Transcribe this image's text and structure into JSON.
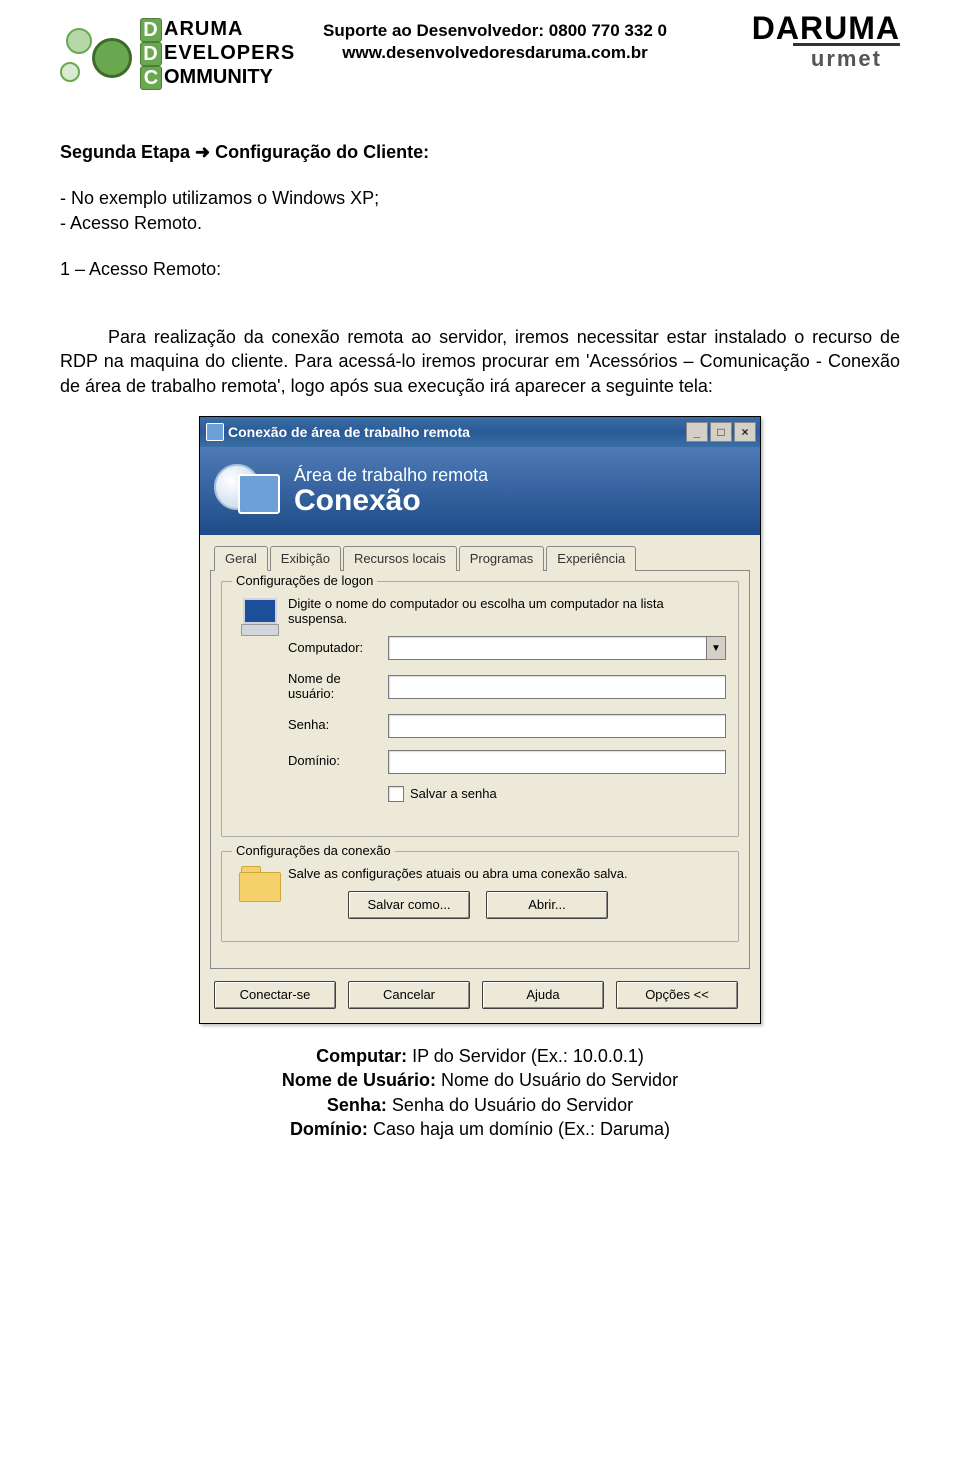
{
  "header": {
    "support_line": "Suporte ao Desenvolvedor: 0800 770 332 0",
    "site_line": "www.desenvolvedoresdaruma.com.br",
    "left_logo": {
      "line1": "ARUMA",
      "line2": "EVELOPERS",
      "line3": "OMMUNITY",
      "d": "D",
      "c": "C"
    },
    "right_logo": {
      "brand1": "DARUMA",
      "brand2": "urmet"
    }
  },
  "body": {
    "title_part1": "Segunda Etapa ",
    "title_part2": " Configuração do Cliente:",
    "line1": "- No exemplo utilizamos o Windows XP;",
    "line2": "- Acesso Remoto.",
    "step_title": "1 – Acesso Remoto:",
    "paragraph": "Para realização da conexão remota ao servidor, iremos necessitar estar instalado o recurso de RDP na maquina do cliente. Para acessá-lo iremos procurar em 'Acessórios – Comunicação - Conexão de área de trabalho remota', logo após sua execução irá aparecer a seguinte tela:"
  },
  "dialog": {
    "title": "Conexão de área de trabalho remota",
    "banner_line1": "Área de trabalho remota",
    "banner_line2": "Conexão",
    "tabs": [
      "Geral",
      "Exibição",
      "Recursos locais",
      "Programas",
      "Experiência"
    ],
    "group1": {
      "title": "Configurações de logon",
      "instr": "Digite o nome do computador ou escolha um computador na lista suspensa.",
      "lbl_computer": "Computador:",
      "lbl_user": "Nome de usuário:",
      "lbl_pass": "Senha:",
      "lbl_domain": "Domínio:",
      "chk_save": "Salvar a senha"
    },
    "group2": {
      "title": "Configurações da conexão",
      "instr": "Salve as configurações atuais ou abra uma conexão salva.",
      "btn_saveas": "Salvar como...",
      "btn_open": "Abrir..."
    },
    "buttons": {
      "connect": "Conectar-se",
      "cancel": "Cancelar",
      "help": "Ajuda",
      "options": "Opções <<"
    },
    "winbtns": {
      "min": "_",
      "max": "□",
      "close": "×"
    }
  },
  "footer": {
    "l1_label": "Computar:",
    "l1_value": " IP do Servidor (Ex.: 10.0.0.1)",
    "l2_label": "Nome de Usuário:",
    "l2_value": " Nome do Usuário do Servidor",
    "l3_label": "Senha:",
    "l3_value": " Senha do Usuário do Servidor",
    "l4_label": "Domínio:",
    "l4_value": " Caso haja um domínio (Ex.: Daruma)"
  }
}
